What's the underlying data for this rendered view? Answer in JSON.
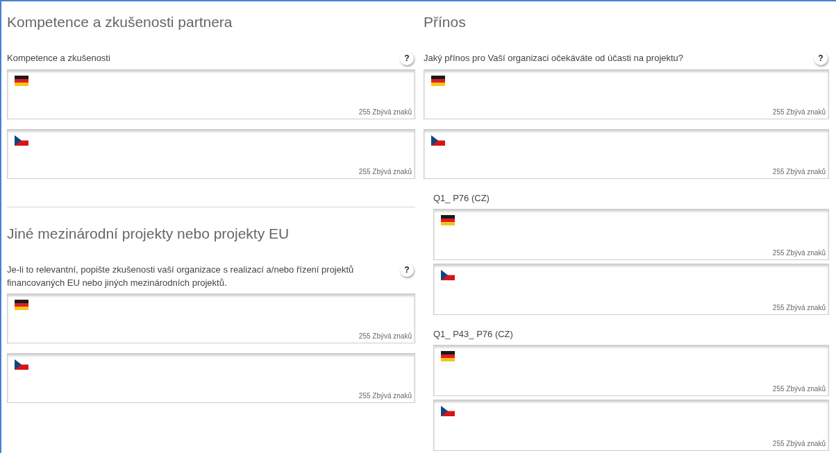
{
  "columns": [
    {
      "sections": [
        {
          "title": "Kompetence a zkušenosti partnera",
          "fields": [
            {
              "kind": "main",
              "label": "Kompetence a zkušenosti",
              "help": "?",
              "editors": [
                {
                  "kind": "german",
                  "counter": "255 Zbývá znaků"
                },
                {
                  "kind": "czech",
                  "counter": "255 Zbývá znaků"
                }
              ]
            }
          ]
        },
        {
          "title": "Jiné mezinárodní projekty nebo projekty EU",
          "fields": [
            {
              "kind": "main",
              "label": "Je-li to relevantní, popište zkušenosti vaší organizace s realizací a/nebo řízení projektů financovaných EU nebo jiných mezinárodních projektů.",
              "help": "?",
              "editors": [
                {
                  "kind": "german",
                  "counter": "255 Zbývá znaků"
                },
                {
                  "kind": "czech",
                  "counter": "255 Zbývá znaků"
                }
              ]
            }
          ]
        }
      ]
    },
    {
      "sections": [
        {
          "title": "Přínos",
          "fields": [
            {
              "kind": "main",
              "label": "Jaký přínos pro Vaší organizaci očekáváte od účasti na projektu?",
              "help": "?",
              "editors": [
                {
                  "kind": "german",
                  "counter": "255 Zbývá znaků"
                },
                {
                  "kind": "czech",
                  "counter": "255 Zbývá znaků"
                }
              ]
            },
            {
              "kind": "sub",
              "label": "Q1_ P76 (CZ)",
              "editors": [
                {
                  "kind": "german",
                  "counter": "255 Zbývá znaků"
                },
                {
                  "kind": "czech",
                  "counter": "255 Zbývá znaků"
                }
              ]
            },
            {
              "kind": "sub",
              "label": "Q1_ P43_ P76 (CZ)",
              "editors": [
                {
                  "kind": "german",
                  "counter": "255 Zbývá znaků"
                },
                {
                  "kind": "czech",
                  "counter": "255 Zbývá znaků"
                }
              ]
            }
          ]
        }
      ]
    }
  ]
}
